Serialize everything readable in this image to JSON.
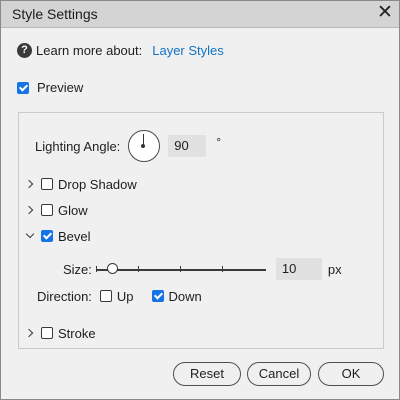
{
  "window": {
    "title": "Style Settings",
    "close_glyph": "✕"
  },
  "learn": {
    "prefix": "Learn more about:",
    "link": "Layer Styles",
    "icon": "help-icon"
  },
  "preview": {
    "label": "Preview",
    "checked": true
  },
  "lighting": {
    "label": "Lighting Angle:",
    "value": "90",
    "unit": "°"
  },
  "effects": [
    {
      "label": "Drop Shadow",
      "checked": false,
      "expanded": false
    },
    {
      "label": "Glow",
      "checked": false,
      "expanded": false
    },
    {
      "label": "Bevel",
      "checked": true,
      "expanded": true
    },
    {
      "label": "Stroke",
      "checked": false,
      "expanded": false
    }
  ],
  "bevel": {
    "size_label": "Size:",
    "size_value": "10",
    "size_unit": "px",
    "direction_label": "Direction:",
    "up": {
      "label": "Up",
      "checked": false
    },
    "down": {
      "label": "Down",
      "checked": true
    }
  },
  "buttons": {
    "reset": "Reset",
    "cancel": "Cancel",
    "ok": "OK"
  },
  "colors": {
    "accent": "#1473e6",
    "link": "#1473c6",
    "titlebar": "#d4d4d4",
    "background": "#f0f0f0"
  }
}
